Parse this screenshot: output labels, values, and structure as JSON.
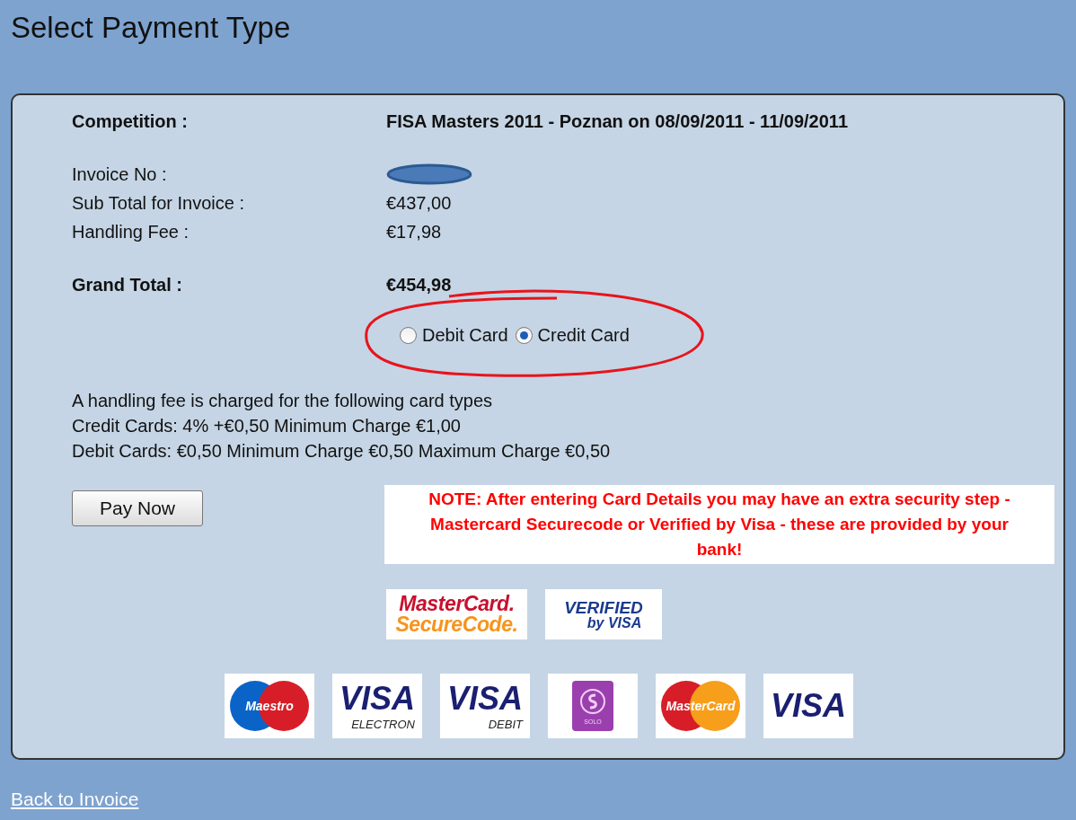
{
  "title": "Select Payment Type",
  "competition": {
    "label": "Competition :",
    "value": "FISA Masters 2011 - Poznan on 08/09/2011 - 11/09/2011"
  },
  "details": [
    {
      "label": "Invoice No :",
      "redacted": true
    },
    {
      "label": "Sub Total for Invoice :",
      "value": "€437,00"
    },
    {
      "label": "Handling Fee :",
      "value": "€17,98"
    }
  ],
  "grand_total": {
    "label": "Grand Total :",
    "value": "€454,98"
  },
  "payment_options": [
    {
      "label": "Debit Card",
      "selected": false
    },
    {
      "label": "Credit Card",
      "selected": true
    }
  ],
  "fee_notes": [
    "A handling fee is charged for the following card types",
    "Credit Cards: 4% +€0,50 Minimum Charge €1,00",
    "Debit Cards: €0,50 Minimum Charge €0,50 Maximum Charge €0,50"
  ],
  "pay_button": "Pay Now",
  "note": "NOTE: After entering Card Details you may have an extra security step - Mastercard Securecode or Verified by Visa - these are provided by your bank!",
  "security_logos": [
    {
      "kind": "securecode",
      "texts": [
        "MasterCard.",
        "SecureCode."
      ]
    },
    {
      "kind": "verified",
      "texts": [
        "VERIFIED",
        "by VISA"
      ]
    }
  ],
  "card_logos": [
    {
      "kind": "maestro",
      "texts": [
        "Maestro"
      ]
    },
    {
      "kind": "visa",
      "texts": [
        "VISA",
        "ELECTRON"
      ]
    },
    {
      "kind": "visa",
      "texts": [
        "VISA",
        "DEBIT"
      ]
    },
    {
      "kind": "solo",
      "texts": [
        "SOLO"
      ]
    },
    {
      "kind": "mastercard",
      "texts": [
        "MasterCard"
      ]
    },
    {
      "kind": "visa",
      "texts": [
        "VISA"
      ]
    }
  ],
  "back_link": "Back to Invoice"
}
